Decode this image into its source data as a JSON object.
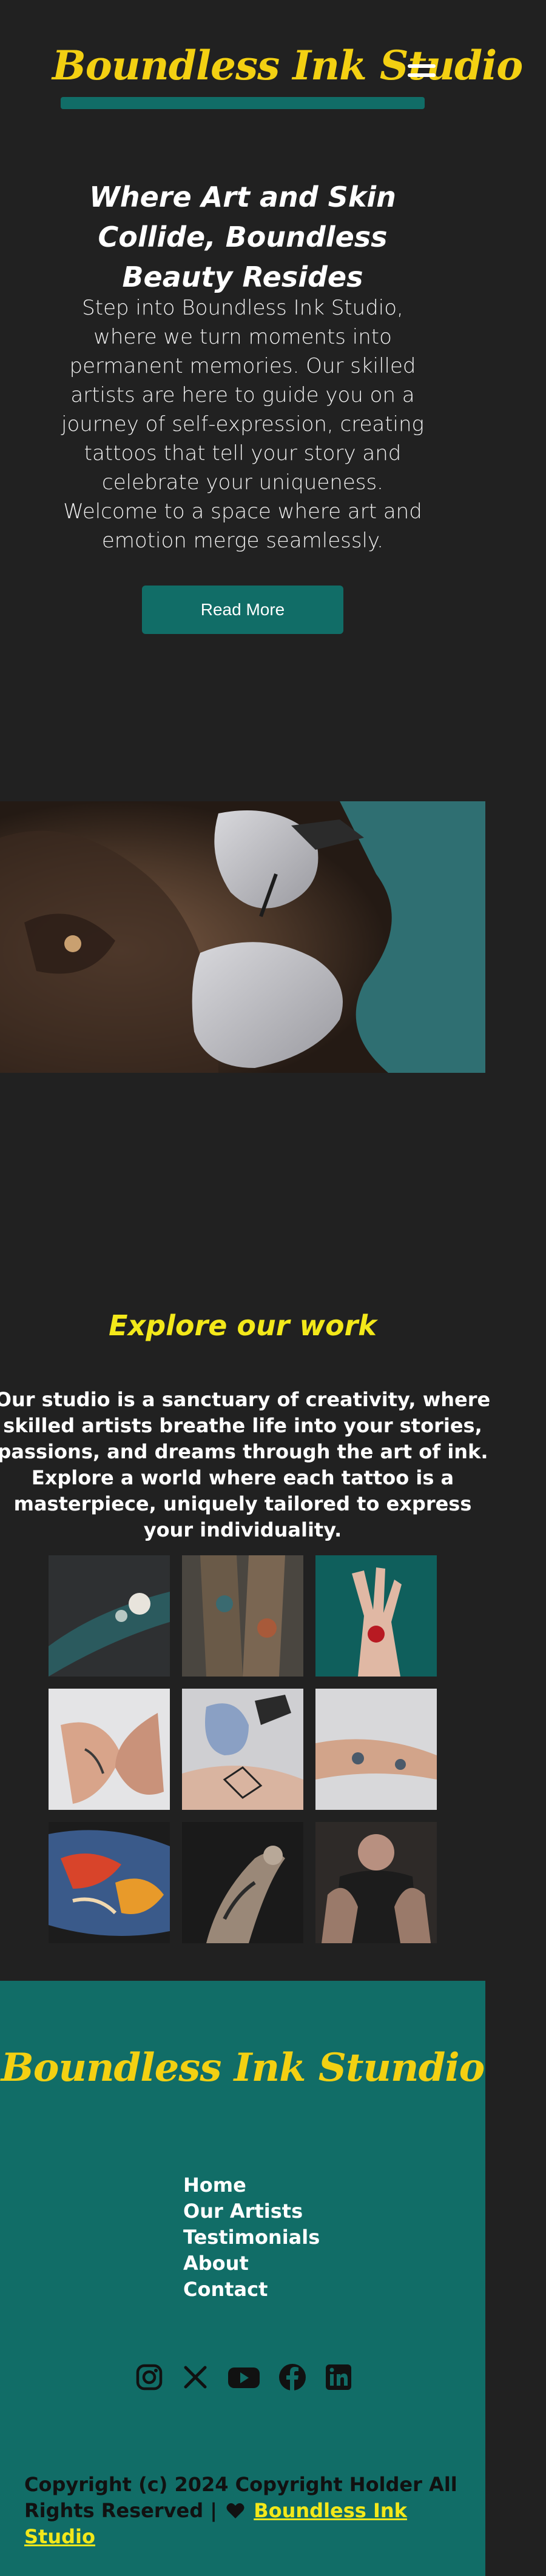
{
  "header": {
    "brand": "Boundless Ink Studio",
    "menu_icon": "hamburger-menu-icon"
  },
  "hero": {
    "title": "Where Art and Skin Collide, Boundless Beauty Resides",
    "text": "Step into Boundless Ink Studio, where we turn moments into permanent memories. Our skilled artists are here to guide you on a journey of self-expression, creating tattoos that tell your story and celebrate your uniqueness. Welcome to a space where art and emotion merge seamlessly.",
    "button_label": "Read More"
  },
  "explore": {
    "title": "Explore our work",
    "text": "Our studio is a sanctuary of creativity, where skilled artists breathe life into your stories, passions, and dreams through the art of ink. Explore a world where each tattoo is a masterpiece, uniquely tailored to express your individuality."
  },
  "footer": {
    "brand": "Boundless Ink Stundio",
    "nav": [
      "Home",
      "Our Artists",
      "Testimonials",
      "About",
      "Contact"
    ],
    "socials": [
      "instagram-icon",
      "x-icon",
      "youtube-icon",
      "facebook-icon",
      "linkedin-icon"
    ],
    "copyright_prefix": "Copyright (c) 2024 Copyright Holder All Rights Reserved |",
    "copyright_link": "Boundless Ink Studio"
  },
  "colors": {
    "background": "#212121",
    "accent": "#116d67",
    "brand_yellow": "#f3d012"
  }
}
